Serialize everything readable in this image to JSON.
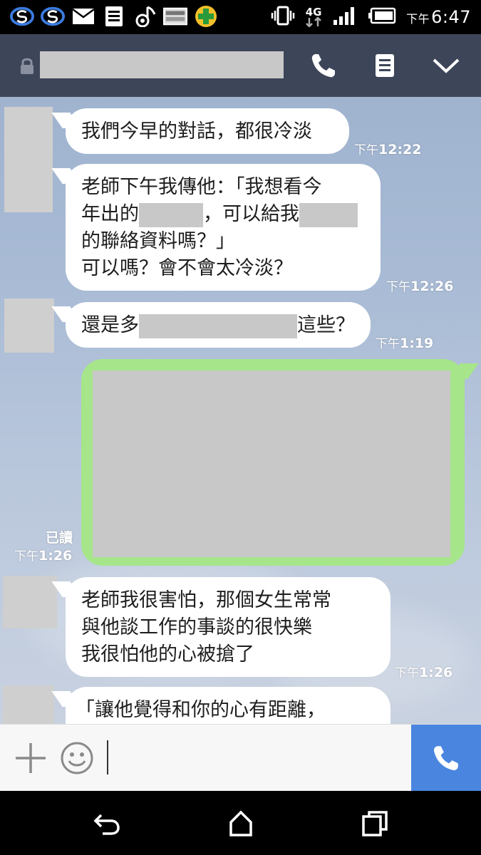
{
  "status_bar": {
    "icons": [
      "s-app-icon",
      "s-app-icon",
      "mail-icon",
      "notes-icon",
      "music-icon",
      "image-icon",
      "plus-app-icon"
    ],
    "right_icons": [
      "vibrate-icon",
      "4g-icon",
      "signal-icon",
      "battery-icon"
    ],
    "network": "4G",
    "time_ampm": "下午",
    "time": "6:47"
  },
  "header": {
    "icons": [
      "lock-icon",
      "phone-icon",
      "menu-icon",
      "chevron-down-icon"
    ]
  },
  "messages": [
    {
      "type": "in",
      "lines": [
        "我們今早的對話，都很冷淡"
      ],
      "time_ampm": "下午",
      "time": "12:22"
    },
    {
      "type": "in",
      "line1": "老師下午我傳他：「我想看今",
      "line2a": "年出的",
      "line2b": "，可以給我",
      "line3": "的聯絡資料嗎？」",
      "line4": "可以嗎？會不會太冷淡？",
      "time_ampm": "下午",
      "time": "12:26"
    },
    {
      "type": "in",
      "part_a": "還是多",
      "part_b": "這些？",
      "time_ampm": "下午",
      "time": "1:19"
    },
    {
      "type": "out",
      "read": "已讀",
      "time_ampm": "下午",
      "time": "1:26"
    },
    {
      "type": "in",
      "lines": [
        "老師我很害怕，那個女生常常",
        "與他談工作的事談的很快樂",
        "我很怕他的心被搶了"
      ],
      "time_ampm": "下午",
      "time": "1:26"
    },
    {
      "type": "in",
      "lines": [
        "「讓他覺得和你的心有距離，"
      ]
    }
  ],
  "input_bar": {
    "icons": [
      "plus-icon",
      "emoji-icon",
      "phone-icon"
    ],
    "value": ""
  },
  "nav_bar": {
    "icons": [
      "back-icon",
      "home-icon",
      "recents-icon"
    ]
  },
  "colors": {
    "header_bg": "#3d4559",
    "outgoing_bubble": "#a6e58a",
    "call_button": "#4a86e0",
    "chat_bg": "#a9bbd5"
  }
}
